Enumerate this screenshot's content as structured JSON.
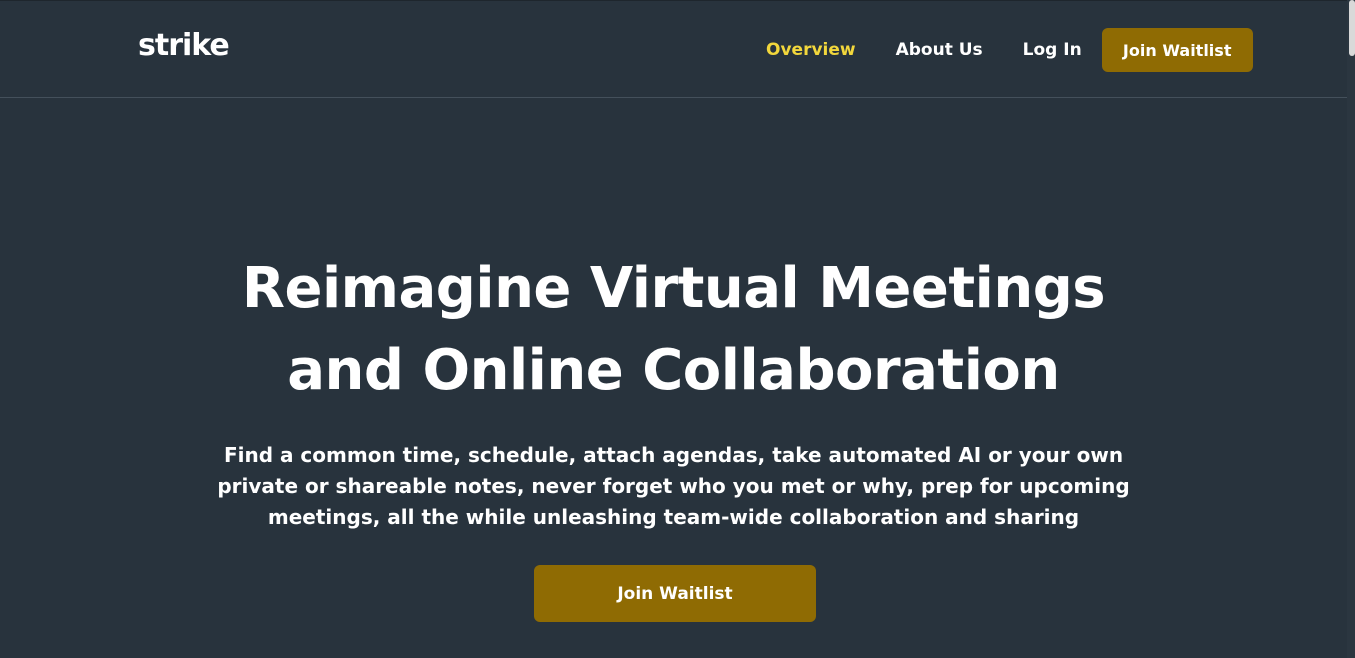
{
  "header": {
    "logo_text": "strike",
    "nav": {
      "overview": "Overview",
      "about": "About Us",
      "login": "Log In",
      "cta": "Join Waitlist"
    }
  },
  "hero": {
    "title_line1": "Reimagine Virtual Meetings",
    "title_line2": "and Online Collaboration",
    "subtitle": "Find a common time, schedule, attach agendas, take automated AI or your own private or shareable notes, never forget who you met or why, prep for upcoming meetings, all the while unleashing team-wide collaboration and sharing",
    "cta": "Join Waitlist"
  },
  "colors": {
    "background": "#28333d",
    "accent_gold": "#8f6b03",
    "active_nav": "#f2d73c",
    "text": "#ffffff"
  }
}
